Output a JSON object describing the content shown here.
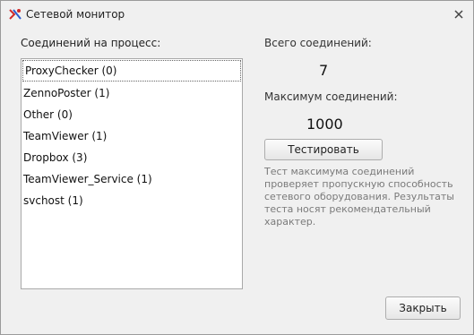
{
  "window": {
    "title": "Сетевой монитор",
    "icon": "network-monitor-icon",
    "close_icon": "close-icon"
  },
  "connections": {
    "label": "Соединений на процесс:",
    "items": [
      {
        "label": "ProxyChecker (0)",
        "selected": true
      },
      {
        "label": "ZennoPoster (1)"
      },
      {
        "label": "Other (0)"
      },
      {
        "label": "TeamViewer (1)"
      },
      {
        "label": "Dropbox (3)"
      },
      {
        "label": "TeamViewer_Service (1)"
      },
      {
        "label": "svchost (1)"
      }
    ]
  },
  "stats": {
    "total_label": "Всего соединений:",
    "total_value": "7",
    "max_label": "Максимум соединений:",
    "max_value": "1000",
    "test_button": "Тестировать",
    "note": "Тест максимума соединений проверяет пропускную способность сетевого оборудования. Результаты теста носят рекомендательный характер."
  },
  "footer": {
    "close_button": "Закрыть"
  }
}
